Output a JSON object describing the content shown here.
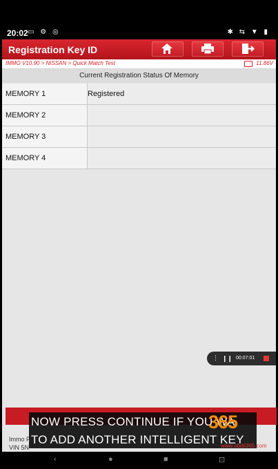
{
  "status_bar": {
    "time": "20:02",
    "left_icons": "▭ ⚙ ◎",
    "right_icons": "✱ ⇆ ▼ ▮"
  },
  "app": {
    "title": "Registration Key ID",
    "toolbar_icons": [
      "home-icon",
      "print-icon",
      "exit-icon"
    ],
    "breadcrumb": "IMMO V10.90 > NISSAN > Quick Match Test",
    "voltage": "11.86V",
    "table": {
      "header": "Current Registration Status Of Memory",
      "rows": [
        {
          "label": "MEMORY 1",
          "value": "Registered"
        },
        {
          "label": "MEMORY 2",
          "value": ""
        },
        {
          "label": "MEMORY 3",
          "value": ""
        },
        {
          "label": "MEMORY 4",
          "value": ""
        }
      ]
    },
    "info": {
      "immo": "Immo P",
      "vin": "VIN 5N"
    }
  },
  "recorder": {
    "time": "00:07:01"
  },
  "subtitle": {
    "line1": "NOW PRESS CONTINUE IF YOU WA",
    "line2": "TO ADD ANOTHER INTELLIGENT KEY"
  },
  "watermark": {
    "number": "365",
    "site": "www.obdii365.com"
  },
  "nav": {
    "back": "‹",
    "home": "●",
    "recents": "■",
    "screenshot": "⊡"
  },
  "colors": {
    "accent": "#c71c24",
    "background": "#e6e6e6",
    "watermark": "#f28c0f"
  }
}
